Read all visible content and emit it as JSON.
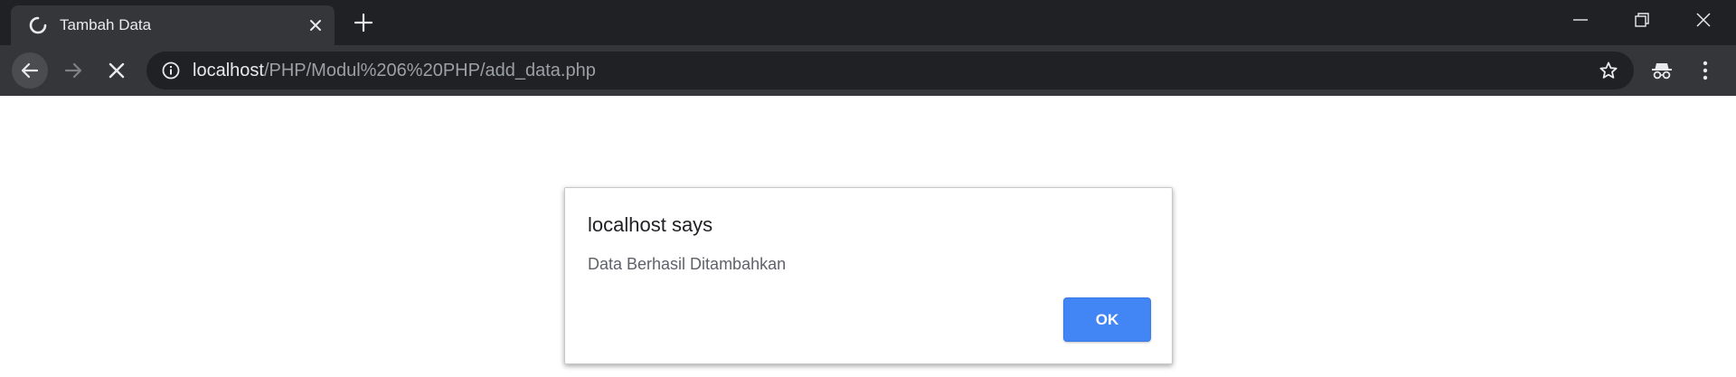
{
  "browser": {
    "tab": {
      "title": "Tambah Data",
      "status_icon": "loading-spinner-icon"
    },
    "address_bar": {
      "host": "localhost",
      "path": "/PHP/Modul%206%20PHP/add_data.php"
    },
    "colors": {
      "tabstrip": "#202124",
      "toolbar": "#35363a",
      "omnibox": "#202124",
      "text_primary": "#e8eaed",
      "text_secondary": "#9aa0a6"
    }
  },
  "dialog": {
    "title": "localhost says",
    "message": "Data Berhasil Ditambahkan",
    "ok_label": "OK",
    "accent": "#4285f4"
  }
}
